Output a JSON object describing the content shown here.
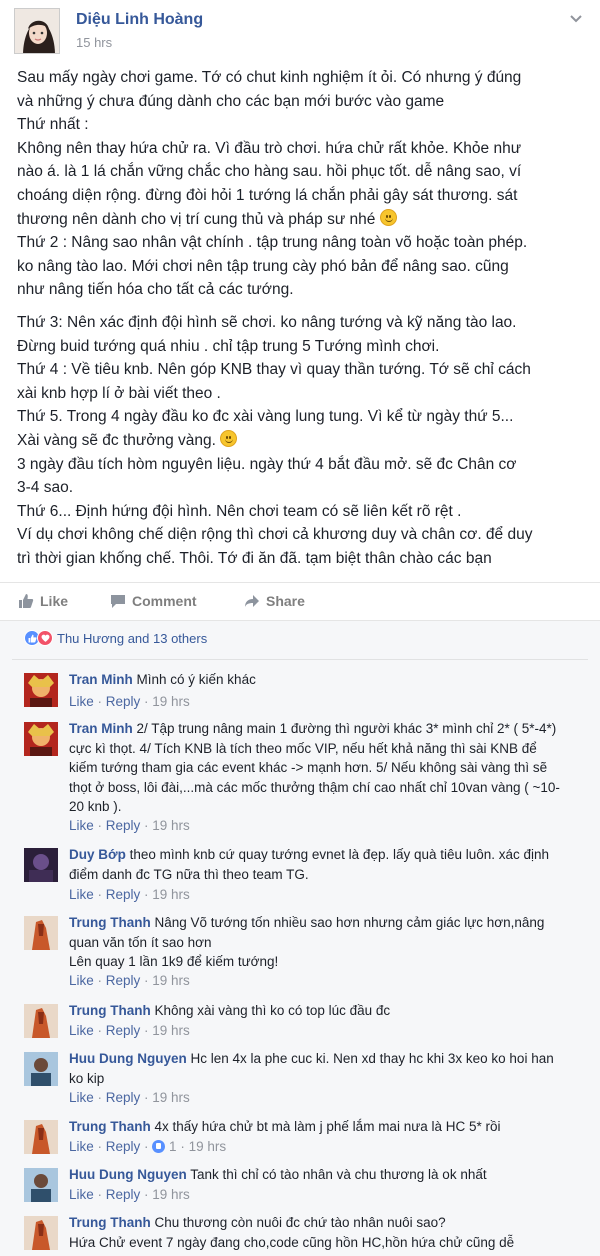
{
  "post": {
    "author": "Diệu Linh Hoàng",
    "time": "15 hrs",
    "menu_icon": "chevron-down-icon",
    "body": {
      "l1": "Sau mấy ngày chơi game. Tớ có chut kinh nghiệm ít ỏi. Có nhưng ý đúng",
      "l2": "và những ý chưa đúng dành cho các bạn mới bước vào game",
      "l3": "Thứ nhất :",
      "l4": "Không nên thay hứa chử ra. Vì đầu trò chơi. hứa chử rất khỏe. Khỏe như",
      "l5": "nào á. là 1 lá chắn vững chắc cho hàng sau. hồi phục tốt. dễ nâng sao, ví",
      "l6": "choáng diện rộng. đừng đòi hỏi 1 tướng lá chắn phải gây sát thương. sát",
      "l7": "thương nên dành cho vị trí cung thủ và pháp sư nhé",
      "l8": "Thứ 2 : Nâng sao nhân vật chính . tập trung nâng toàn võ hoặc toàn phép.",
      "l9": "ko nâng tào lao. Mới chơi nên tập trung cày phó bản để nâng sao. cũng",
      "l10": "như nâng tiến hóa cho tất cả các tướng.",
      "l11": "Thứ 3: Nên xác định đội hình sẽ chơi. ko nâng tướng và kỹ năng tào lao.",
      "l12": "Đừng buid tướng quá nhiu . chỉ tập trung 5 Tướng mình chơi.",
      "l13": "Thứ 4 : Về tiêu knb. Nên góp KNB thay vì quay thần tướng. Tớ sẽ chỉ cách",
      "l14": "xài knb hợp lí ở bài viết theo .",
      "l15": "Thứ 5. Trong 4 ngày đầu ko đc xài vàng lung tung. Vì kể từ ngày thứ 5...",
      "l16": "Xài vàng sẽ đc thưởng vàng.",
      "l17": "3 ngày đầu tích hòm nguyên liệu. ngày thứ 4 bắt đầu mở. sẽ đc Chân cơ",
      "l18": "3-4 sao.",
      "l19": "Thứ 6... Định hứng đội hình. Nên chơi team có sẽ liên kết rõ rệt .",
      "l20": "Ví dụ chơi không chế diện rộng thì chơi cả khương duy và chân cơ. để duy",
      "l21": "trì thời gian khống chế. Thôi. Tớ đi ăn đã. tạm biệt thân chào các bạn"
    },
    "actions": {
      "like": "Like",
      "comment": "Comment",
      "share": "Share"
    }
  },
  "reactions": {
    "text": "Thu Hương and 13 others"
  },
  "comment_meta": {
    "like": "Like",
    "reply": "Reply",
    "sep": " · "
  },
  "comments": [
    {
      "author": "Tran Minh",
      "text": "Mình có ý kiến khác",
      "time": "19 hrs"
    },
    {
      "author": "Tran Minh",
      "text": "2/ Tập trung nâng main 1 đường thì người khác 3* mình chỉ 2* ( 5*-4*) cực kì thọt. 4/ Tích KNB là tích theo mốc VIP, nếu hết khả năng thì sài KNB để kiếm tướng tham gia các event khác -> mạnh hơn. 5/ Nếu không sài vàng thì sẽ thọt ở boss, lôi đài,...mà các mốc thưởng thậm chí cao nhất chỉ 10van vàng ( ~10-20 knb ).",
      "time": "19 hrs"
    },
    {
      "author": "Duy Bớp",
      "text": "theo mình knb cứ quay tướng evnet là đẹp. lấy quà tiêu luôn. xác định điểm danh đc TG nữa thì theo team TG.",
      "time": "19 hrs"
    },
    {
      "author": "Trung Thanh",
      "text": "Nâng Võ tướng tốn nhiều sao hơn nhưng cảm giác lực hơn,nâng quan văn tốn ít sao hơn",
      "text2": "Lên quay 1 lần 1k9 để kiếm tướng!",
      "time": "19 hrs"
    },
    {
      "author": "Trung Thanh",
      "text": "Không xài vàng thì ko có top lúc đầu đc",
      "time": "19 hrs"
    },
    {
      "author": "Huu Dung Nguyen",
      "text": "Hc len 4x la phe cuc ki. Nen xd thay hc khi 3x keo ko hoi han ko kip",
      "time": "19 hrs"
    },
    {
      "author": "Trung Thanh",
      "text": "4x thấy hứa chử bt mà làm j phế lắm mai nưa là HC 5* rồi",
      "time": "19 hrs",
      "likes": "1"
    },
    {
      "author": "Huu Dung Nguyen",
      "text": "Tank thì chỉ có tào nhân và chu thương là ok nhất",
      "time": "19 hrs"
    },
    {
      "author": "Trung Thanh",
      "text": "Chu thương còn nuôi đc chứ tào nhân nuôi sao?",
      "text2": "Hứa Chử event 7 ngày đang cho,code cũng hồn HC,hồn hứa chử cũng dễ"
    }
  ]
}
